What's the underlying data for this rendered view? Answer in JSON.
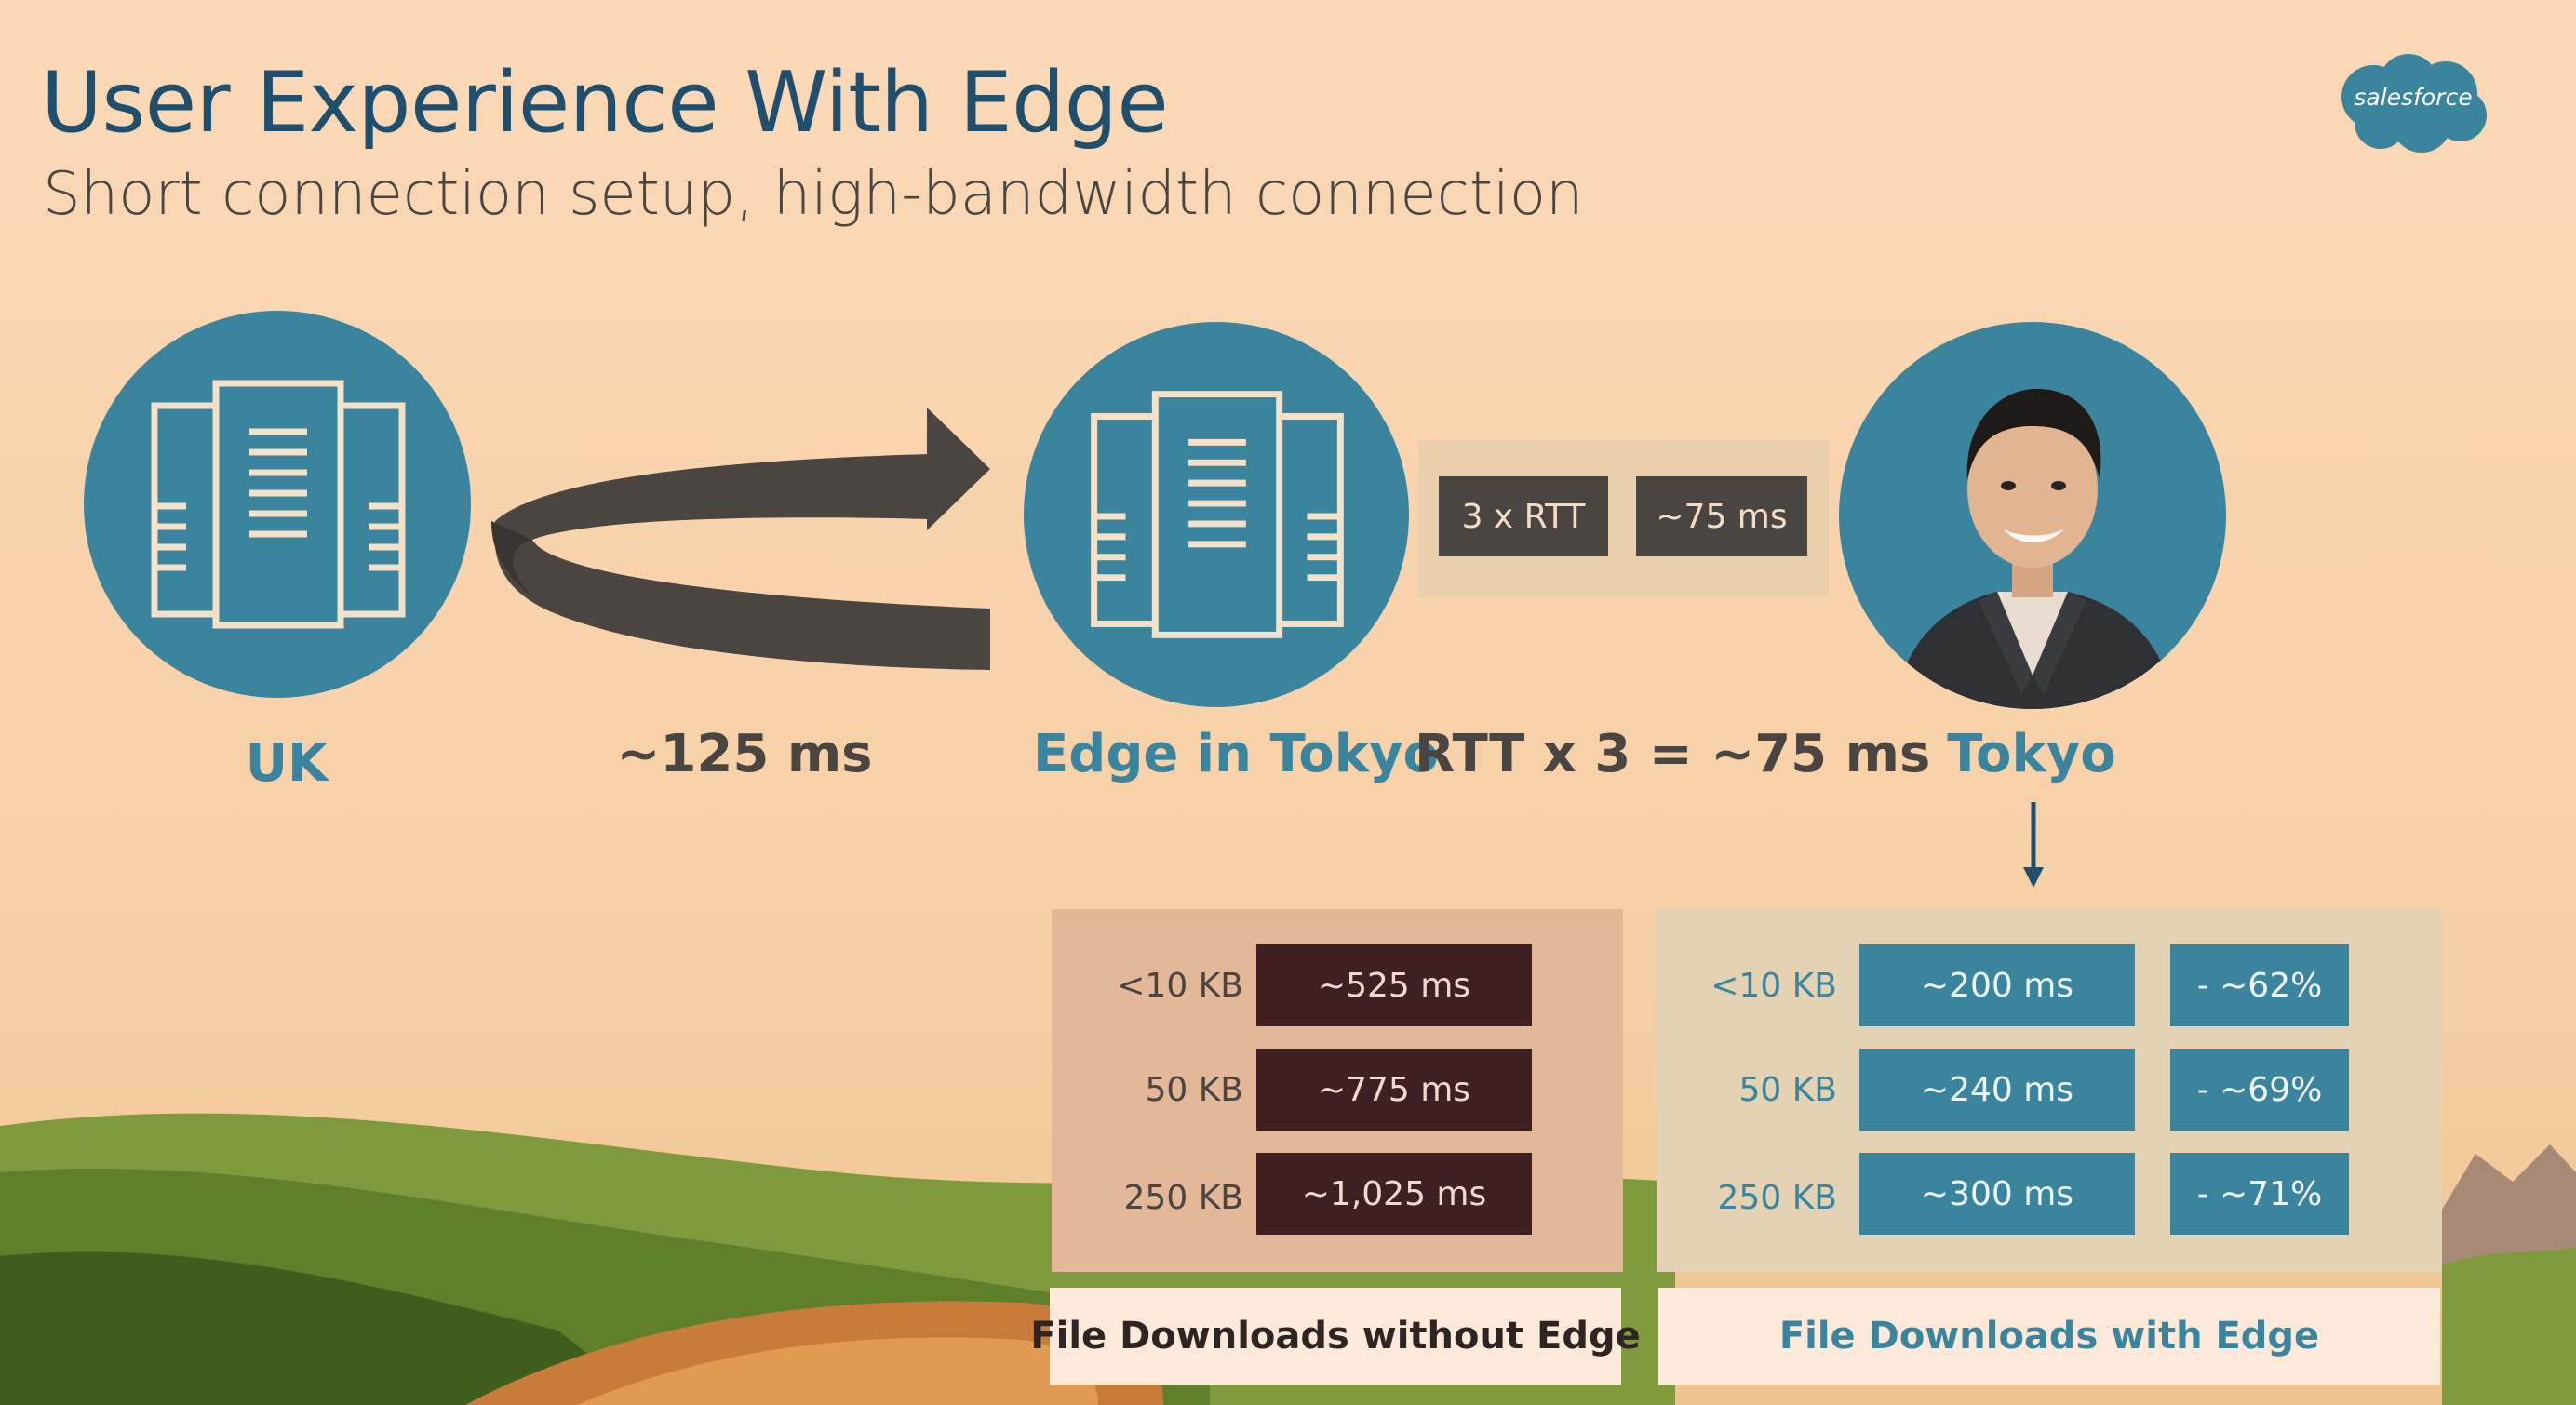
{
  "header": {
    "title": "User Experience With Edge",
    "subtitle": "Short connection setup, high-bandwidth connection"
  },
  "logo": {
    "text": "salesforce"
  },
  "nodes": {
    "uk": {
      "label": "UK",
      "icon": "server-icon"
    },
    "edge": {
      "label": "Edge in Tokyo",
      "icon": "server-icon"
    },
    "tokyo": {
      "label": "Tokyo",
      "icon": "person-photo"
    }
  },
  "latency": {
    "uk_to_edge": "~125 ms",
    "rtt_formula": "RTT x 3 = ~75 ms",
    "rtt_chip": "3 x RTT",
    "ms_chip": "~75 ms"
  },
  "without_edge": {
    "caption": "File Downloads without Edge",
    "rows": [
      {
        "size": "<10 KB",
        "time": "~525 ms"
      },
      {
        "size": "50 KB",
        "time": "~775 ms"
      },
      {
        "size": "250 KB",
        "time": "~1,025 ms"
      }
    ]
  },
  "with_edge": {
    "caption": "File Downloads with Edge",
    "rows": [
      {
        "size": "<10 KB",
        "time": "~200 ms",
        "saving": "- ~62%"
      },
      {
        "size": "50 KB",
        "time": "~240 ms",
        "saving": "- ~69%"
      },
      {
        "size": "250 KB",
        "time": "~300 ms",
        "saving": "- ~71%"
      }
    ]
  },
  "colors": {
    "background": "#fbd9b8",
    "teal": "#3b849d",
    "dark": "#4a4541",
    "maroon": "#3f1f22",
    "title": "#1f4f6c"
  }
}
